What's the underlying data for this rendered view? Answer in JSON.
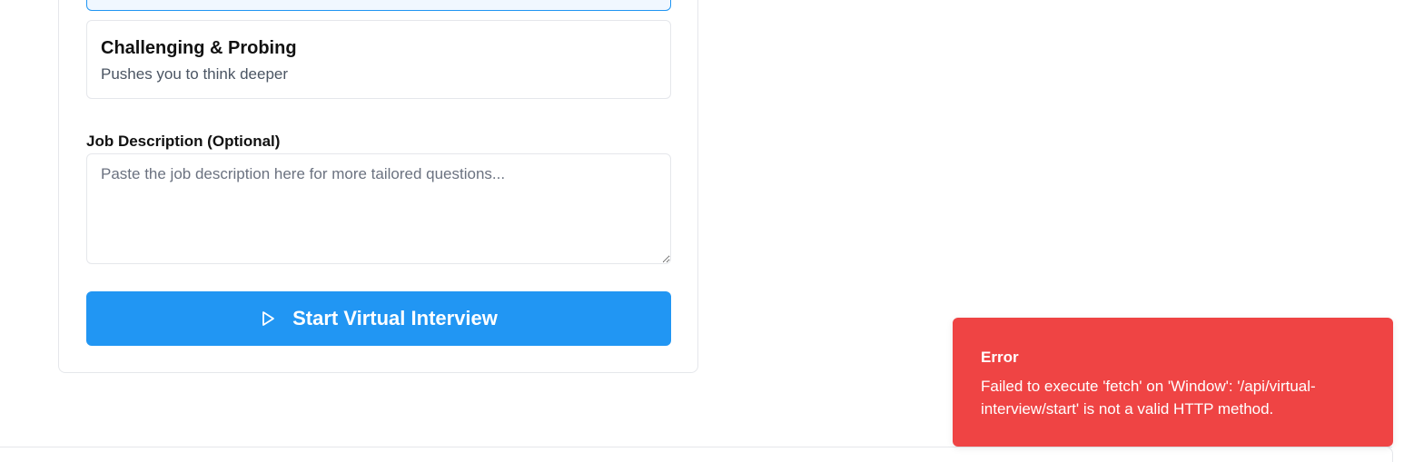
{
  "interviewer_style": {
    "option": {
      "title": "Challenging & Probing",
      "description": "Pushes you to think deeper"
    }
  },
  "job_description": {
    "label": "Job Description (Optional)",
    "placeholder": "Paste the job description here for more tailored questions...",
    "value": ""
  },
  "start_button": {
    "label": "Start Virtual Interview",
    "icon": "play-icon"
  },
  "toast": {
    "title": "Error",
    "message": "Failed to execute 'fetch' on 'Window': '/api/virtual-interview/start' is not a valid HTTP method."
  },
  "colors": {
    "primary": "#2196f3",
    "error": "#ef4444",
    "border": "#e5e7eb"
  }
}
